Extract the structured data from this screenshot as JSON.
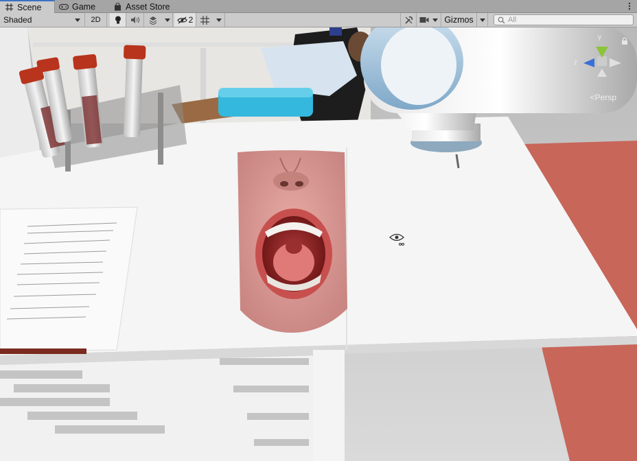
{
  "tabs": [
    {
      "label": "Scene",
      "icon": "scene-grid-icon",
      "active": true
    },
    {
      "label": "Game",
      "icon": "gamepad-icon",
      "active": false
    },
    {
      "label": "Asset Store",
      "icon": "shopping-bag-icon",
      "active": false
    }
  ],
  "toolbar": {
    "draw_mode": "Shaded",
    "mode_2d": "2D",
    "hidden_count": "2",
    "gizmos_label": "Gizmos",
    "search_placeholder": "All"
  },
  "scene": {
    "camera_projection": "Persp",
    "gizmo_axes": {
      "y": "y",
      "z": "z"
    }
  },
  "colors": {
    "tabbar_bg": "#a5a5a5",
    "toolbar_bg": "#cbcbcb",
    "active_tab_accent": "#3a72c4",
    "axis_y": "#8bc53a",
    "axis_z": "#3a6fd6",
    "table_white": "#f4f4f4",
    "floor_red": "#c8665a"
  }
}
